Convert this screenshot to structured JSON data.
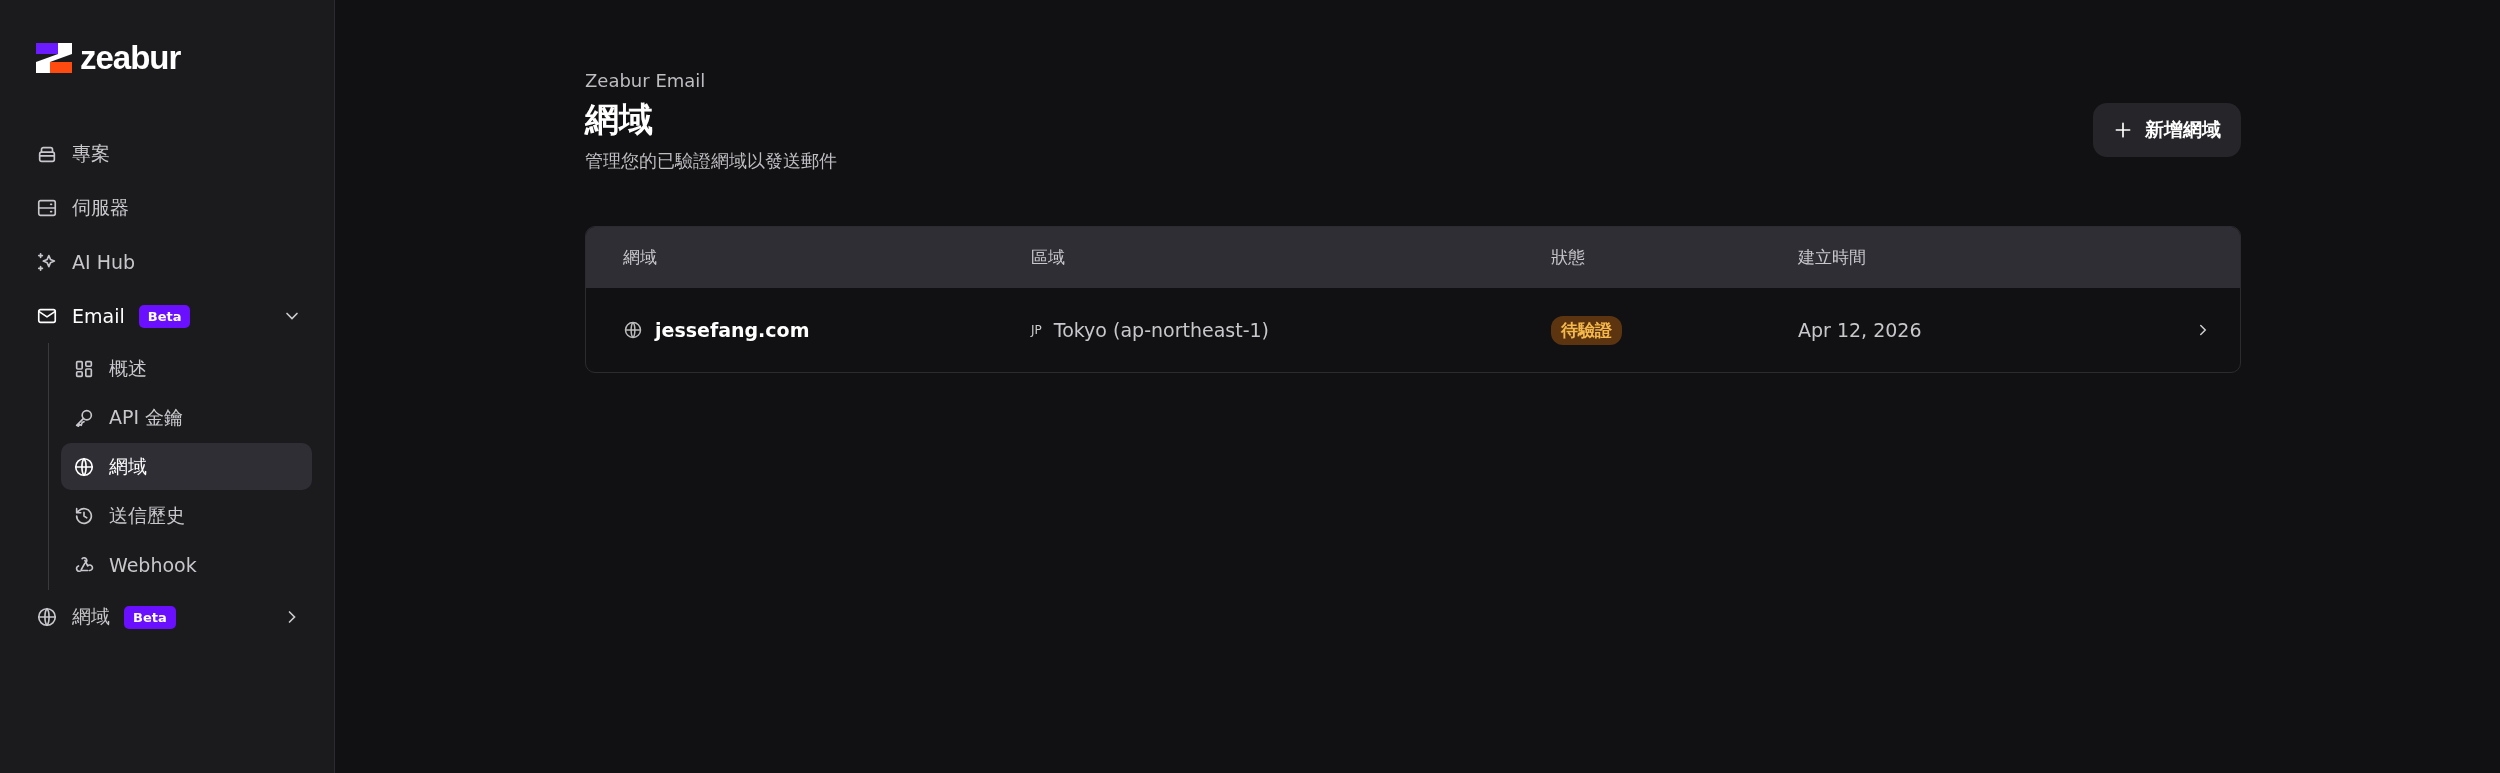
{
  "sidebar": {
    "logo": "zeabur",
    "items": [
      {
        "label": "專案",
        "selected": false
      },
      {
        "label": "伺服器",
        "selected": false
      },
      {
        "label": "AI Hub",
        "selected": false
      },
      {
        "label": "Email",
        "selected": false,
        "badge": "Beta",
        "expanded": true,
        "children": [
          {
            "label": "概述",
            "selected": false
          },
          {
            "label": "API 金鑰",
            "selected": false
          },
          {
            "label": "網域",
            "selected": true
          },
          {
            "label": "送信歷史",
            "selected": false
          },
          {
            "label": "Webhook",
            "selected": false
          }
        ]
      },
      {
        "label": "網域",
        "selected": false,
        "badge": "Beta",
        "expanded": false
      }
    ]
  },
  "header": {
    "eyebrow": "Zeabur Email",
    "title": "網域",
    "description": "管理您的已驗證網域以發送郵件",
    "add_button": "新增網域"
  },
  "table": {
    "columns": [
      "網域",
      "區域",
      "狀態",
      "建立時間"
    ],
    "rows": [
      {
        "domain": "jessefang.com",
        "region_code": "JP",
        "region": "Tokyo (ap-northeast-1)",
        "status": "待驗證",
        "created": "Apr 12, 2026"
      }
    ]
  }
}
